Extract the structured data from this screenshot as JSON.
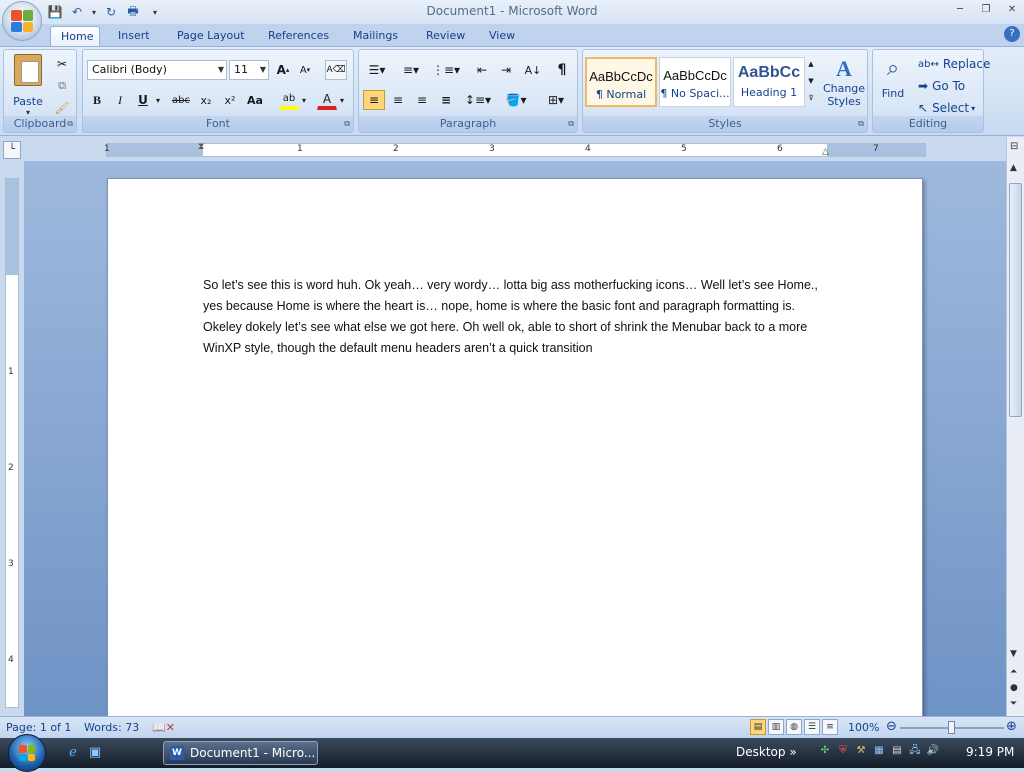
{
  "window": {
    "title": "Document1 - Microsoft Word"
  },
  "qat": {
    "save": "save-icon",
    "undo": "undo-icon",
    "redo": "redo-icon",
    "more": "customize-icon"
  },
  "tabs": [
    "Home",
    "Insert",
    "Page Layout",
    "References",
    "Mailings",
    "Review",
    "View"
  ],
  "active_tab": "Home",
  "ribbon": {
    "clipboard": {
      "label": "Clipboard",
      "paste": "Paste"
    },
    "font": {
      "label": "Font",
      "name": "Calibri (Body)",
      "size": "11",
      "buttons": {
        "bold": "B",
        "italic": "I",
        "underline": "U",
        "strike": "abc",
        "subscript": "x₂",
        "superscript": "x²",
        "case": "Aa"
      }
    },
    "paragraph": {
      "label": "Paragraph",
      "pilcrow": "¶"
    },
    "styles": {
      "label": "Styles",
      "items": [
        {
          "sample": "AaBbCcDc",
          "name": "¶ Normal"
        },
        {
          "sample": "AaBbCcDc",
          "name": "¶ No Spaci..."
        },
        {
          "sample": "AaBbCc",
          "name": "Heading 1"
        }
      ],
      "change_styles": "Change Styles"
    },
    "editing": {
      "label": "Editing",
      "find": "Find",
      "replace": "Replace",
      "goto": "Go To",
      "select": "Select"
    }
  },
  "ruler": {
    "numbers": [
      "1",
      "1",
      "2",
      "3",
      "4",
      "5",
      "6",
      "7"
    ]
  },
  "vruler": {
    "numbers": [
      "1",
      "2",
      "3",
      "4"
    ]
  },
  "document": {
    "text": "So let’s see this is word huh.  Ok yeah… very wordy… lotta big ass motherfucking icons… Well let’s see Home., yes because Home is where the heart is…  nope, home is where the basic font and paragraph formatting is.  Okeley dokely let’s see what else we got here.  Oh well ok, able to short of shrink the Menubar back to a more WinXP style, though the default menu headers aren’t a quick transition"
  },
  "status": {
    "page": "Page: 1 of 1",
    "words": "Words: 73",
    "zoom": "100%",
    "zoom_level": 1.0
  },
  "taskbar": {
    "task": "Document1 - Micro...",
    "desktop": "Desktop",
    "clock": "9:19 PM"
  },
  "colors": {
    "accent": "#15428b",
    "ribbon": "#d9e6f6",
    "highlight": "#f0b860"
  }
}
